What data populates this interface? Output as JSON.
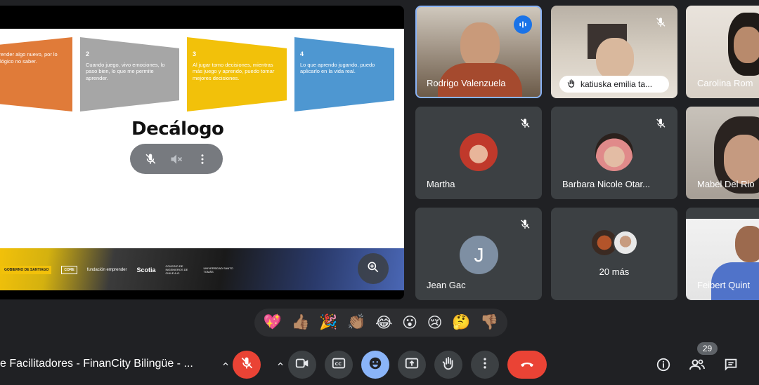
{
  "presentation": {
    "steps": [
      {
        "num": "",
        "text": "aprender algo nuevo, por lo lógico no saber."
      },
      {
        "num": "2",
        "text": "Cuando juego, vivo emociones, lo paso bien, lo que me permite aprender."
      },
      {
        "num": "3",
        "text": "Al jugar tomo decisiones, mientras más juego y aprendo, puedo tomar mejores decisiones."
      },
      {
        "num": "4",
        "text": "Lo que aprendo jugando, puedo aplicarlo en la vida real."
      }
    ],
    "title": "Decálogo",
    "footer_logos": [
      "GOBIERNO DE SANTIAGO",
      "CORE",
      "fundación emprender",
      "Scotia",
      "COLEGIO DE INGENIEROS DE CHILE A.G.",
      "UNIVERSIDAD SANTO TOMÁS"
    ],
    "controls": [
      "mic-off-icon",
      "volume-off-icon",
      "more-vert-icon"
    ],
    "zoom_icon": "zoom-in-icon"
  },
  "participants": [
    {
      "name": "Rodrigo Valenzuela",
      "state": "speaking"
    },
    {
      "name": "katiuska emilia ta...",
      "state": "hand-raised"
    },
    {
      "name": "Carolina Rom",
      "state": "video"
    },
    {
      "name": "Martha",
      "state": "muted"
    },
    {
      "name": "Barbara Nicole Otar...",
      "state": "muted"
    },
    {
      "name": "Mabel Del Rio",
      "state": "video"
    },
    {
      "name": "Jean Gac",
      "initial": "J",
      "state": "muted"
    },
    {
      "name": "20 más",
      "state": "overflow"
    },
    {
      "name": "Feibert Quint",
      "state": "video"
    }
  ],
  "reactions": [
    "💖",
    "👍🏽",
    "🎉",
    "👏🏽",
    "😂",
    "😮",
    "😢",
    "🤔",
    "👎🏽"
  ],
  "meeting": {
    "title": "e Facilitadores - FinanCity Bilingüe - ...",
    "participant_count": "29"
  },
  "controls": {
    "mic": "mic-off-icon",
    "camera": "videocam-icon",
    "captions": "closed-captions-icon",
    "effects": "emoji-icon",
    "present": "present-screen-icon",
    "hand": "raise-hand-icon",
    "more": "more-vert-icon",
    "leave": "call-end-icon",
    "info": "info-icon",
    "people": "people-icon",
    "chat": "chat-icon"
  },
  "colors": {
    "background": "#202124",
    "tile": "#3c4043",
    "leave": "#ea4335",
    "active": "#8ab4f8",
    "speaking_border": "#8ab4f8"
  }
}
